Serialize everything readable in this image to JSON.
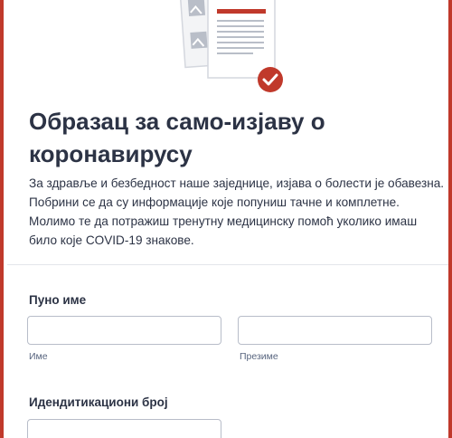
{
  "form": {
    "title_line1": "Образац за само-изјаву о",
    "title_line2": "коронавирусу",
    "description_line1": "За здравље и безбедност наше заједнице, изјава о болести је обавезна.",
    "description_line2": "Побрини се да су информације које попуниш тачне и комплетне.",
    "description_line3": "Молимо те да потражиш тренутну медицинску помоћ уколико имаш",
    "description_line4": "било које COVID-19 знакове.",
    "accent_color": "#c0392b"
  },
  "fields": {
    "full_name": {
      "label": "Пуно име",
      "first_name_value": "",
      "first_name_sublabel": "Име",
      "last_name_value": "",
      "last_name_sublabel": "Презиме"
    },
    "id_number": {
      "label": "Идендитикациони број",
      "value": ""
    }
  },
  "icons": {
    "illustration": "document-checkmark-icon",
    "check": "checkmark-badge-icon"
  }
}
